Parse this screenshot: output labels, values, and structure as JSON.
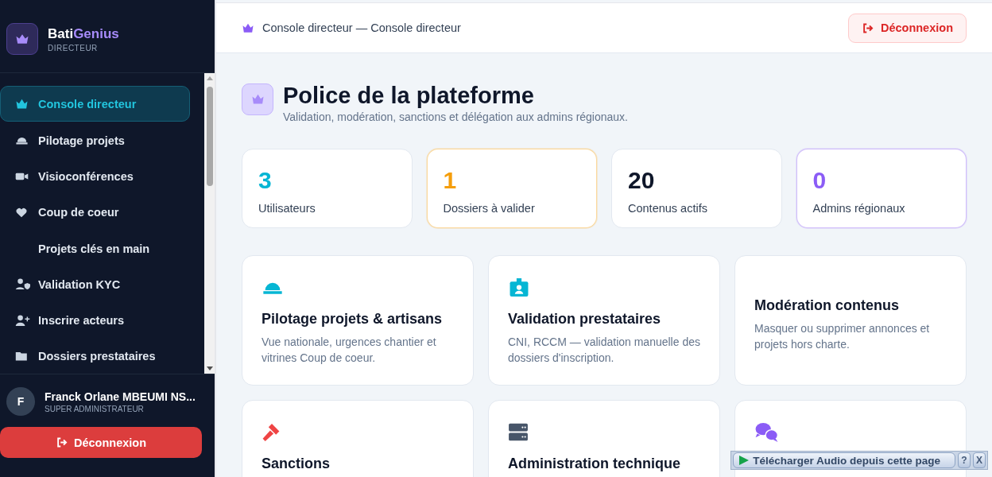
{
  "sidebar": {
    "brand": {
      "name_part1": "Bati",
      "name_part2": "Genius",
      "role": "DIRECTEUR"
    },
    "items": [
      {
        "label": "Console directeur",
        "selected": true
      },
      {
        "label": "Pilotage projets",
        "selected": false
      },
      {
        "label": "Visioconférences",
        "selected": false
      },
      {
        "label": "Coup de coeur",
        "selected": false
      },
      {
        "label": "Projets clés en main",
        "selected": false
      },
      {
        "label": "Validation KYC",
        "selected": false
      },
      {
        "label": "Inscrire acteurs",
        "selected": false
      },
      {
        "label": "Dossiers prestataires",
        "selected": false
      }
    ],
    "user": {
      "initial": "F",
      "name": "Franck Orlane MBEUMI NS...",
      "role": "SUPER ADMINISTRATEUR"
    },
    "logout": "Déconnexion"
  },
  "header": {
    "breadcrumb": "Console directeur — Console directeur",
    "logout": "Déconnexion"
  },
  "page": {
    "title": "Police de la plateforme",
    "subtitle": "Validation, modération, sanctions et délégation aux admins régionaux."
  },
  "stats": [
    {
      "value": "3",
      "label": "Utilisateurs",
      "color": "#06b6d4",
      "highlighted": false
    },
    {
      "value": "1",
      "label": "Dossiers à valider",
      "color": "#f59e0b",
      "highlighted": true
    },
    {
      "value": "20",
      "label": "Contenus actifs",
      "color": "#0f172a",
      "highlighted": false
    },
    {
      "value": "0",
      "label": "Admins régionaux",
      "color": "#8b5cf6",
      "highlighted": true
    }
  ],
  "features": [
    {
      "title": "Pilotage projets & artisans",
      "description": "Vue nationale, urgences chantier et vitrines Coup de coeur.",
      "kind": "helmet"
    },
    {
      "title": "Validation prestataires",
      "description": "CNI, RCCM — validation manuelle des dossiers d'inscription.",
      "kind": "badge"
    },
    {
      "title": "Modération contenus",
      "description": "Masquer ou supprimer annonces et projets hors charte.",
      "kind": "none"
    },
    {
      "title": "Sanctions",
      "kind": "gavel"
    },
    {
      "title": "Administration technique",
      "kind": "server"
    },
    {
      "kind": "chat"
    }
  ],
  "audio_bar": {
    "label": "Télécharger Audio depuis cette page",
    "help": "?",
    "close": "X"
  }
}
